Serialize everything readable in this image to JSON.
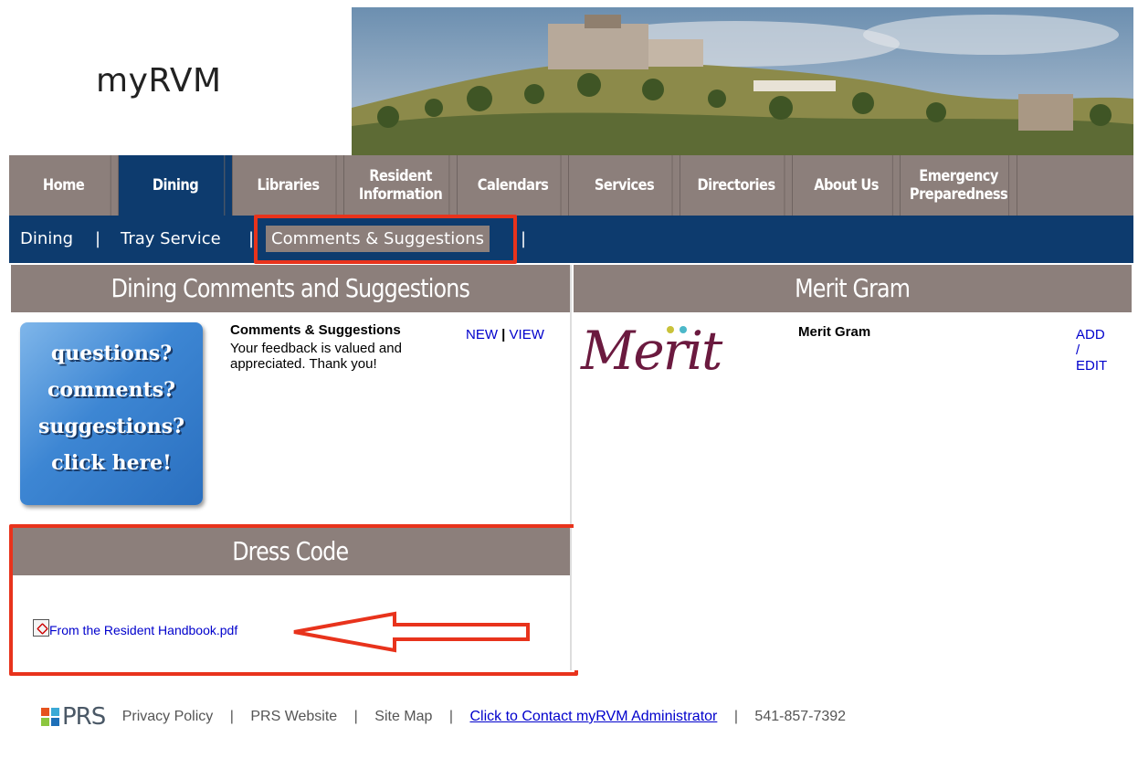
{
  "header": {
    "logo": "myRVM"
  },
  "main_nav": [
    {
      "label": "Home"
    },
    {
      "label": "Dining",
      "active": true
    },
    {
      "label": "Libraries"
    },
    {
      "label": "Resident Information"
    },
    {
      "label": "Calendars"
    },
    {
      "label": "Services"
    },
    {
      "label": "Directories"
    },
    {
      "label": "About Us"
    },
    {
      "label": "Emergency Preparedness"
    }
  ],
  "sub_nav": {
    "items": [
      "Dining",
      "Tray Service",
      "Comments & Suggestions"
    ],
    "separator": "|",
    "active": "Comments & Suggestions"
  },
  "comments_panel": {
    "header": "Dining Comments and Suggestions",
    "image_lines": [
      "questions?",
      "comments?",
      "suggestions?",
      "click here!"
    ],
    "title": "Comments & Suggestions",
    "description": "Your feedback is valued and appreciated. Thank you!",
    "link_new": "NEW",
    "link_sep": "|",
    "link_view": "VIEW"
  },
  "dress_code": {
    "header": "Dress Code",
    "file": "From the Resident Handbook.pdf"
  },
  "merit_panel": {
    "header": "Merit Gram",
    "logo_text": "Merit",
    "title": "Merit Gram",
    "link_add": "ADD",
    "link_slash": "/",
    "link_edit": "EDIT"
  },
  "footer": {
    "brand": "PRS",
    "links": [
      "Privacy Policy",
      "PRS Website",
      "Site Map"
    ],
    "contact_link": "Click to Contact myRVM Administrator",
    "phone": "541-857-7392",
    "separator": "|"
  },
  "colors": {
    "nav_bg": "#8c7f7b",
    "nav_active": "#0d3b6e",
    "annotation_red": "#e8331c",
    "link_blue": "#0000cc"
  }
}
